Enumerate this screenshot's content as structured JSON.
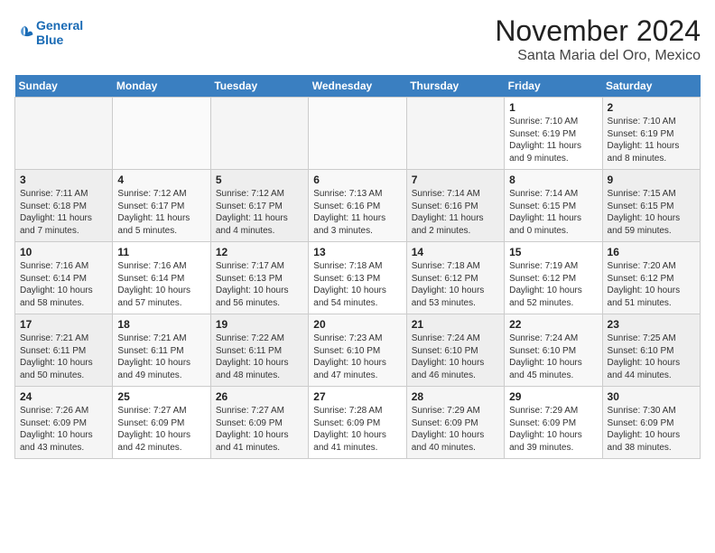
{
  "logo": {
    "line1": "General",
    "line2": "Blue"
  },
  "title": "November 2024",
  "subtitle": "Santa Maria del Oro, Mexico",
  "headers": [
    "Sunday",
    "Monday",
    "Tuesday",
    "Wednesday",
    "Thursday",
    "Friday",
    "Saturday"
  ],
  "weeks": [
    [
      {
        "day": "",
        "info": ""
      },
      {
        "day": "",
        "info": ""
      },
      {
        "day": "",
        "info": ""
      },
      {
        "day": "",
        "info": ""
      },
      {
        "day": "",
        "info": ""
      },
      {
        "day": "1",
        "info": "Sunrise: 7:10 AM\nSunset: 6:19 PM\nDaylight: 11 hours and 9 minutes."
      },
      {
        "day": "2",
        "info": "Sunrise: 7:10 AM\nSunset: 6:19 PM\nDaylight: 11 hours and 8 minutes."
      }
    ],
    [
      {
        "day": "3",
        "info": "Sunrise: 7:11 AM\nSunset: 6:18 PM\nDaylight: 11 hours and 7 minutes."
      },
      {
        "day": "4",
        "info": "Sunrise: 7:12 AM\nSunset: 6:17 PM\nDaylight: 11 hours and 5 minutes."
      },
      {
        "day": "5",
        "info": "Sunrise: 7:12 AM\nSunset: 6:17 PM\nDaylight: 11 hours and 4 minutes."
      },
      {
        "day": "6",
        "info": "Sunrise: 7:13 AM\nSunset: 6:16 PM\nDaylight: 11 hours and 3 minutes."
      },
      {
        "day": "7",
        "info": "Sunrise: 7:14 AM\nSunset: 6:16 PM\nDaylight: 11 hours and 2 minutes."
      },
      {
        "day": "8",
        "info": "Sunrise: 7:14 AM\nSunset: 6:15 PM\nDaylight: 11 hours and 0 minutes."
      },
      {
        "day": "9",
        "info": "Sunrise: 7:15 AM\nSunset: 6:15 PM\nDaylight: 10 hours and 59 minutes."
      }
    ],
    [
      {
        "day": "10",
        "info": "Sunrise: 7:16 AM\nSunset: 6:14 PM\nDaylight: 10 hours and 58 minutes."
      },
      {
        "day": "11",
        "info": "Sunrise: 7:16 AM\nSunset: 6:14 PM\nDaylight: 10 hours and 57 minutes."
      },
      {
        "day": "12",
        "info": "Sunrise: 7:17 AM\nSunset: 6:13 PM\nDaylight: 10 hours and 56 minutes."
      },
      {
        "day": "13",
        "info": "Sunrise: 7:18 AM\nSunset: 6:13 PM\nDaylight: 10 hours and 54 minutes."
      },
      {
        "day": "14",
        "info": "Sunrise: 7:18 AM\nSunset: 6:12 PM\nDaylight: 10 hours and 53 minutes."
      },
      {
        "day": "15",
        "info": "Sunrise: 7:19 AM\nSunset: 6:12 PM\nDaylight: 10 hours and 52 minutes."
      },
      {
        "day": "16",
        "info": "Sunrise: 7:20 AM\nSunset: 6:12 PM\nDaylight: 10 hours and 51 minutes."
      }
    ],
    [
      {
        "day": "17",
        "info": "Sunrise: 7:21 AM\nSunset: 6:11 PM\nDaylight: 10 hours and 50 minutes."
      },
      {
        "day": "18",
        "info": "Sunrise: 7:21 AM\nSunset: 6:11 PM\nDaylight: 10 hours and 49 minutes."
      },
      {
        "day": "19",
        "info": "Sunrise: 7:22 AM\nSunset: 6:11 PM\nDaylight: 10 hours and 48 minutes."
      },
      {
        "day": "20",
        "info": "Sunrise: 7:23 AM\nSunset: 6:10 PM\nDaylight: 10 hours and 47 minutes."
      },
      {
        "day": "21",
        "info": "Sunrise: 7:24 AM\nSunset: 6:10 PM\nDaylight: 10 hours and 46 minutes."
      },
      {
        "day": "22",
        "info": "Sunrise: 7:24 AM\nSunset: 6:10 PM\nDaylight: 10 hours and 45 minutes."
      },
      {
        "day": "23",
        "info": "Sunrise: 7:25 AM\nSunset: 6:10 PM\nDaylight: 10 hours and 44 minutes."
      }
    ],
    [
      {
        "day": "24",
        "info": "Sunrise: 7:26 AM\nSunset: 6:09 PM\nDaylight: 10 hours and 43 minutes."
      },
      {
        "day": "25",
        "info": "Sunrise: 7:27 AM\nSunset: 6:09 PM\nDaylight: 10 hours and 42 minutes."
      },
      {
        "day": "26",
        "info": "Sunrise: 7:27 AM\nSunset: 6:09 PM\nDaylight: 10 hours and 41 minutes."
      },
      {
        "day": "27",
        "info": "Sunrise: 7:28 AM\nSunset: 6:09 PM\nDaylight: 10 hours and 41 minutes."
      },
      {
        "day": "28",
        "info": "Sunrise: 7:29 AM\nSunset: 6:09 PM\nDaylight: 10 hours and 40 minutes."
      },
      {
        "day": "29",
        "info": "Sunrise: 7:29 AM\nSunset: 6:09 PM\nDaylight: 10 hours and 39 minutes."
      },
      {
        "day": "30",
        "info": "Sunrise: 7:30 AM\nSunset: 6:09 PM\nDaylight: 10 hours and 38 minutes."
      }
    ]
  ]
}
